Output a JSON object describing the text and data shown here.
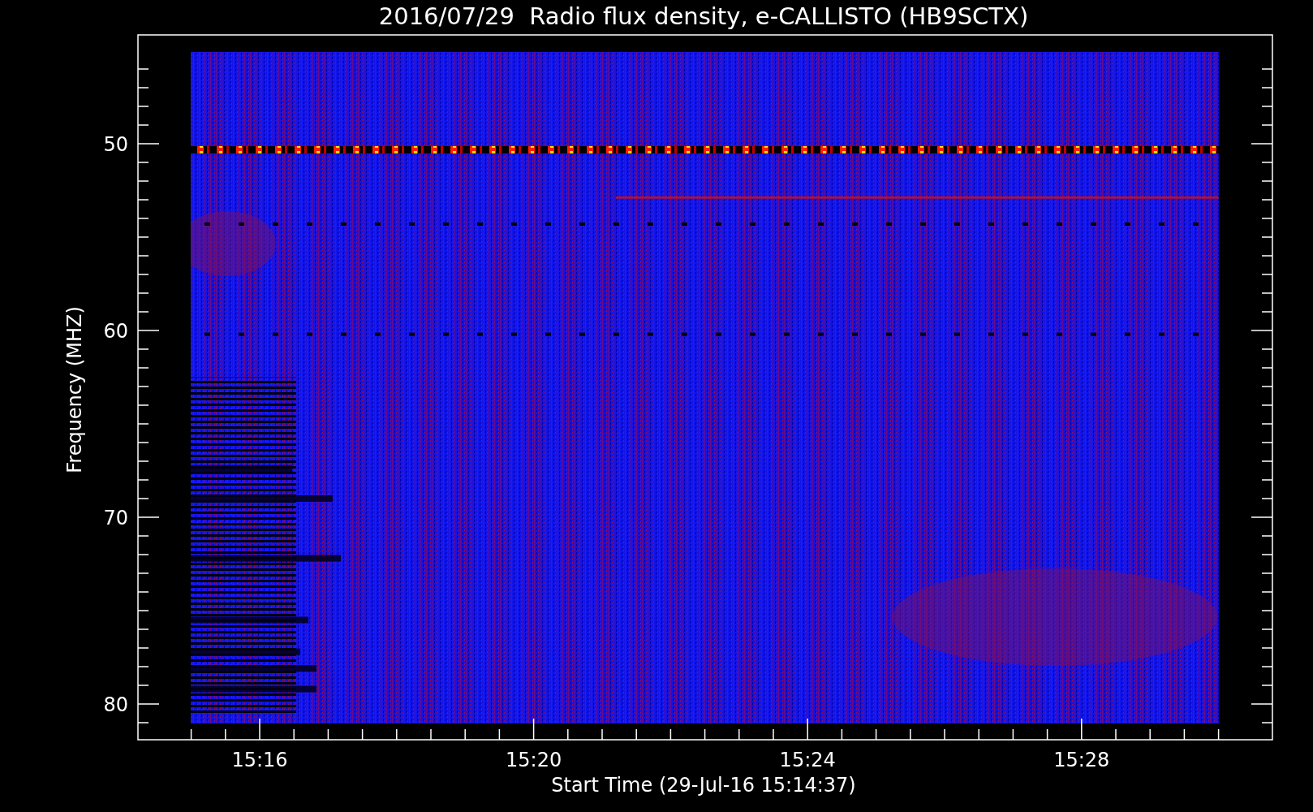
{
  "title": "2016/07/29  Radio flux density, e-CALLISTO (HB9SCTX)",
  "y_axis": {
    "label": "Frequency (MHZ)",
    "ticks": [
      "50",
      "60",
      "70",
      "80"
    ]
  },
  "x_axis": {
    "label": "Start Time (29-Jul-16 15:14:37)",
    "ticks": [
      "15:16",
      "15:20",
      "15:24",
      "15:28"
    ]
  }
}
